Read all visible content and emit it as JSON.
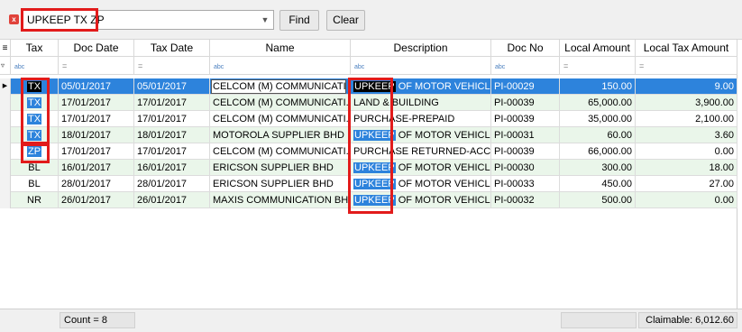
{
  "search": {
    "value": "UPKEEP TX ZP",
    "find_label": "Find",
    "clear_label": "Clear"
  },
  "columns": {
    "tax": "Tax",
    "doc_date": "Doc Date",
    "tax_date": "Tax Date",
    "name": "Name",
    "description": "Description",
    "doc_no": "Doc No",
    "local_amount": "Local Amount",
    "local_tax_amount": "Local Tax Amount"
  },
  "filter": {
    "text_op": "abc",
    "eq_op": "="
  },
  "rows": [
    {
      "tax": "TX",
      "doc_date": "05/01/2017",
      "tax_date": "05/01/2017",
      "name": "CELCOM (M) COMMUNICATI...",
      "desc_hl": "UPKEEP",
      "desc_rest": " OF MOTOR VEHICL...",
      "doc_no": "PI-00029",
      "local_amount": "150.00",
      "local_tax_amount": "9.00"
    },
    {
      "tax": "TX",
      "doc_date": "17/01/2017",
      "tax_date": "17/01/2017",
      "name": "CELCOM (M) COMMUNICATI...",
      "desc_hl": "",
      "desc_rest": "LAND & BUILDING",
      "doc_no": "PI-00039",
      "local_amount": "65,000.00",
      "local_tax_amount": "3,900.00"
    },
    {
      "tax": "TX",
      "doc_date": "17/01/2017",
      "tax_date": "17/01/2017",
      "name": "CELCOM (M) COMMUNICATI...",
      "desc_hl": "",
      "desc_rest": "PURCHASE-PREPAID",
      "doc_no": "PI-00039",
      "local_amount": "35,000.00",
      "local_tax_amount": "2,100.00"
    },
    {
      "tax": "TX",
      "doc_date": "18/01/2017",
      "tax_date": "18/01/2017",
      "name": "MOTOROLA SUPPLIER BHD",
      "desc_hl": "UPKEEP",
      "desc_rest": " OF MOTOR VEHICL...",
      "doc_no": "PI-00031",
      "local_amount": "60.00",
      "local_tax_amount": "3.60"
    },
    {
      "tax": "ZP",
      "doc_date": "17/01/2017",
      "tax_date": "17/01/2017",
      "name": "CELCOM (M) COMMUNICATI...",
      "desc_hl": "",
      "desc_rest": "PURCHASE RETURNED-ACC...",
      "doc_no": "PI-00039",
      "local_amount": "66,000.00",
      "local_tax_amount": "0.00"
    },
    {
      "tax": "BL",
      "doc_date": "16/01/2017",
      "tax_date": "16/01/2017",
      "name": "ERICSON SUPPLIER BHD",
      "desc_hl": "UPKEEP",
      "desc_rest": " OF MOTOR VEHICL...",
      "doc_no": "PI-00030",
      "local_amount": "300.00",
      "local_tax_amount": "18.00"
    },
    {
      "tax": "BL",
      "doc_date": "28/01/2017",
      "tax_date": "28/01/2017",
      "name": "ERICSON SUPPLIER BHD",
      "desc_hl": "UPKEEP",
      "desc_rest": " OF MOTOR VEHICL...",
      "doc_no": "PI-00033",
      "local_amount": "450.00",
      "local_tax_amount": "27.00"
    },
    {
      "tax": "NR",
      "doc_date": "26/01/2017",
      "tax_date": "26/01/2017",
      "name": "MAXIS COMMUNICATION BHD",
      "desc_hl": "UPKEEP",
      "desc_rest": " OF MOTOR VEHICL...",
      "doc_no": "PI-00032",
      "local_amount": "500.00",
      "local_tax_amount": "0.00"
    }
  ],
  "footer": {
    "count": "Count = 8",
    "claimable": "Claimable: 6,012.60"
  }
}
